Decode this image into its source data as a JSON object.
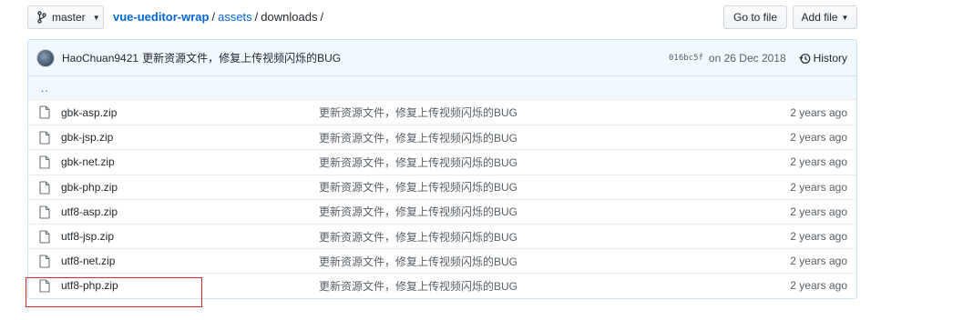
{
  "toolbar": {
    "branch_label": "master",
    "goto_label": "Go to file",
    "add_label": "Add file"
  },
  "breadcrumb": {
    "repo": "vue-ueditor-wrap",
    "folder": "assets",
    "current": "downloads",
    "separator": "/"
  },
  "commit": {
    "author": "HaoChuan9421",
    "message": "更新资源文件，修复上传视频闪烁的BUG",
    "sha": "016bc5f",
    "date": "on 26 Dec 2018",
    "history_label": "History"
  },
  "parent_dir": "..",
  "files": [
    {
      "name": "gbk-asp.zip",
      "message": "更新资源文件，修复上传视频闪烁的BUG",
      "age": "2 years ago"
    },
    {
      "name": "gbk-jsp.zip",
      "message": "更新资源文件，修复上传视频闪烁的BUG",
      "age": "2 years ago"
    },
    {
      "name": "gbk-net.zip",
      "message": "更新资源文件，修复上传视频闪烁的BUG",
      "age": "2 years ago"
    },
    {
      "name": "gbk-php.zip",
      "message": "更新资源文件，修复上传视频闪烁的BUG",
      "age": "2 years ago"
    },
    {
      "name": "utf8-asp.zip",
      "message": "更新资源文件，修复上传视频闪烁的BUG",
      "age": "2 years ago"
    },
    {
      "name": "utf8-jsp.zip",
      "message": "更新资源文件，修复上传视频闪烁的BUG",
      "age": "2 years ago"
    },
    {
      "name": "utf8-net.zip",
      "message": "更新资源文件，修复上传视频闪烁的BUG",
      "age": "2 years ago"
    },
    {
      "name": "utf8-php.zip",
      "message": "更新资源文件，修复上传视频闪烁的BUG",
      "age": "2 years ago"
    }
  ],
  "icons": {
    "branch": "git-branch-icon",
    "history": "history-icon",
    "file": "file-icon"
  },
  "colors": {
    "link": "#0366d6",
    "commit_bar_bg": "#f1f8ff",
    "border_blue": "#c8e1ff",
    "highlight_red": "#e0292b"
  }
}
